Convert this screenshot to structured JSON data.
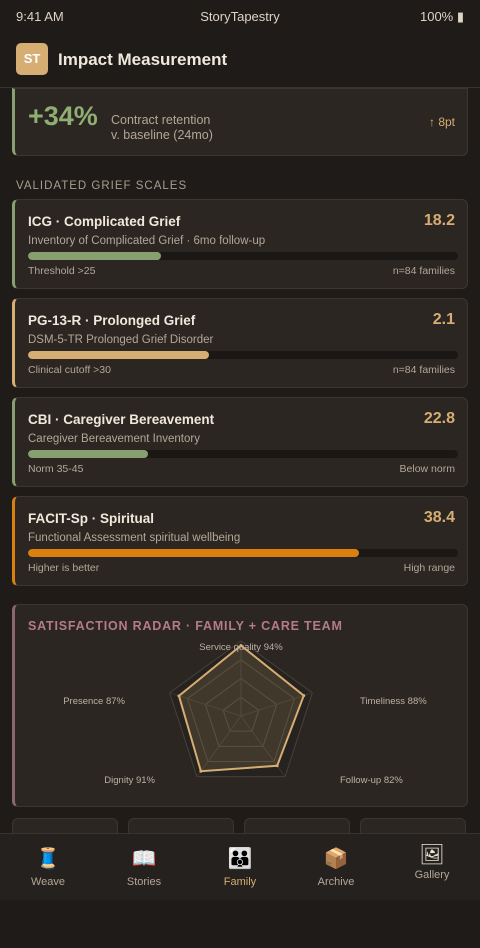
{
  "status_bar": {
    "time": "9:41 AM",
    "app": "StoryTapestry",
    "battery": "100% ▮"
  },
  "header": {
    "logo": "ST",
    "title": "Impact Measurement"
  },
  "hero": {
    "value": "+34%",
    "desc_line1": "Contract retention",
    "desc_line2": "v. baseline (24mo)",
    "delta": "↑ 8pt",
    "accent": "#8fae72"
  },
  "section_label": "VALIDATED GRIEF SCALES",
  "scales": [
    {
      "name": "ICG · Complicated Grief",
      "score": "18.2",
      "sub": "Inventory of Complicated Grief · 6mo follow-up",
      "foot_left": "Threshold >25",
      "foot_right": "n=84 families",
      "fill_fraction": 0.31,
      "color": "#88a070"
    },
    {
      "name": "PG-13-R · Prolonged Grief",
      "score": "2.1",
      "sub": "DSM-5-TR Prolonged Grief Disorder",
      "foot_left": "Clinical cutoff >30",
      "foot_right": "n=84 families",
      "fill_fraction": 0.42,
      "color": "#d6ad72"
    },
    {
      "name": "CBI · Caregiver Bereavement",
      "score": "22.8",
      "sub": "Caregiver Bereavement Inventory",
      "foot_left": "Norm 35-45",
      "foot_right": "Below norm",
      "fill_fraction": 0.28,
      "color": "#88a070"
    },
    {
      "name": "FACIT-Sp · Spiritual",
      "score": "38.4",
      "sub": "Functional Assessment spiritual wellbeing",
      "foot_left": "Higher is better",
      "foot_right": "High range",
      "fill_fraction": 0.77,
      "color": "#d9800f"
    }
  ],
  "chart_data": {
    "type": "radar",
    "title": "SATISFACTION RADAR · FAMILY + CARE TEAM",
    "axes": [
      {
        "label": "Service quality 94%",
        "value": 94
      },
      {
        "label": "Timeliness 88%",
        "value": 88
      },
      {
        "label": "Follow-up 82%",
        "value": 82
      },
      {
        "label": "Dignity 91%",
        "value": 91
      },
      {
        "label": "Presence 87%",
        "value": 87
      }
    ],
    "max": 100,
    "color": "#d6ad72"
  },
  "tabs": [
    {
      "label": "Weave",
      "icon": "🧵",
      "icon_name": "spool-icon",
      "active": false
    },
    {
      "label": "Stories",
      "icon": "📖",
      "icon_name": "book-icon",
      "active": false
    },
    {
      "label": "Family",
      "icon": "👪",
      "icon_name": "family-icon",
      "active": true
    },
    {
      "label": "Archive",
      "icon": "📦",
      "icon_name": "box-icon",
      "active": false
    },
    {
      "label": "Gallery",
      "icon": "🖼",
      "icon_name": "picture-icon",
      "active": false
    }
  ]
}
